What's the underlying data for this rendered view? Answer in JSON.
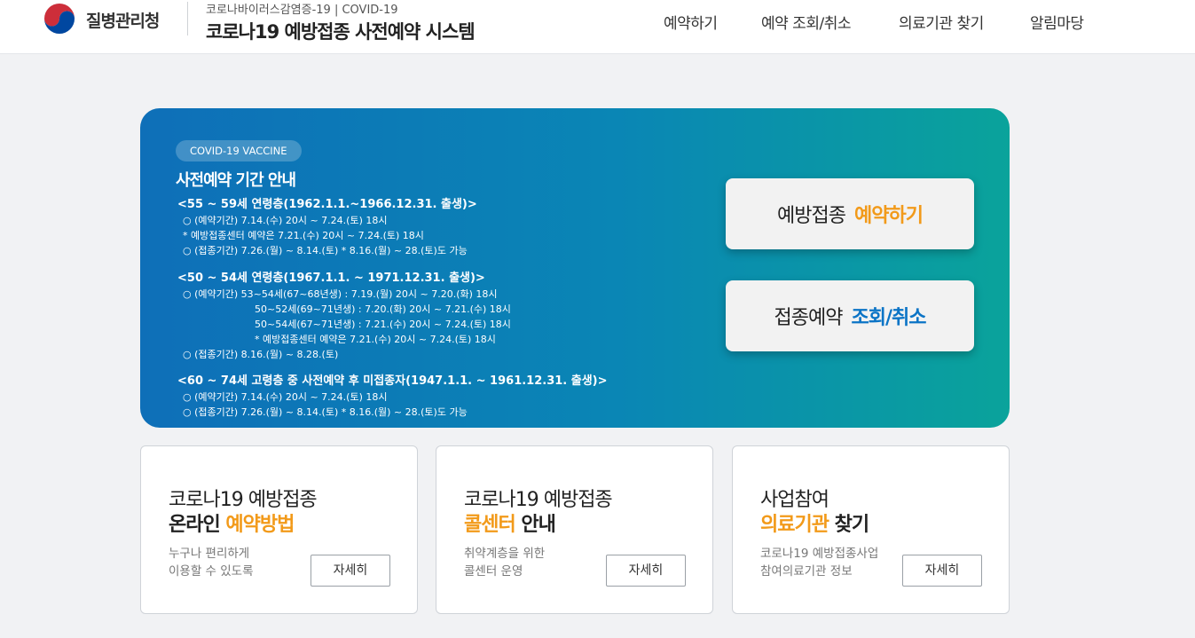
{
  "header": {
    "agency": "질병관리청",
    "subtitle": "코로나바이러스감염증-19 | COVID-19",
    "title": "코로나19 예방접종 사전예약 시스템",
    "nav": [
      "예약하기",
      "예약 조회/취소",
      "의료기관 찾기",
      "알림마당"
    ]
  },
  "hero": {
    "badge": "COVID-19 VACCINE",
    "title": "사전예약 기간 안내",
    "sections": [
      {
        "head": "<55 ~ 59세 연령층(1962.1.1.~1966.12.31. 출생)>",
        "lines": [
          "○ (예약기간) 7.14.(수) 20시 ~ 7.24.(토) 18시",
          " * 예방접종센터 예약은 7.21.(수) 20시 ~ 7.24.(토) 18시",
          "○ (접종기간) 7.26.(월) ~ 8.14.(토)        * 8.16.(월) ~ 28.(토)도 가능"
        ]
      },
      {
        "head": "<50 ~ 54세 연령층(1967.1.1. ~ 1971.12.31. 출생)>",
        "lines": [
          "○ (예약기간) 53~54세(67~68년생) : 7.19.(월) 20시 ~ 7.20.(화) 18시",
          "50~52세(69~71년생) : 7.20.(화) 20시 ~ 7.21.(수) 18시",
          "50~54세(67~71년생) : 7.21.(수) 20시 ~ 7.24.(토) 18시",
          "* 예방접종센터 예약은 7.21.(수) 20시 ~ 7.24.(토) 18시",
          "○ (접종기간) 8.16.(월) ~ 8.28.(토)"
        ]
      },
      {
        "head": "<60 ~ 74세 고령층 중 사전예약 후 미접종자(1947.1.1. ~ 1961.12.31. 출생)>",
        "lines": [
          "○ (예약기간) 7.14.(수) 20시 ~ 7.24.(토) 18시",
          "○ (접종기간) 7.26.(월) ~ 8.14.(토)        * 8.16.(월) ~ 28.(토)도 가능"
        ]
      }
    ],
    "btn_reserve": {
      "part1": "예방접종",
      "part2": "예약하기"
    },
    "btn_lookup": {
      "part1": "접종예약",
      "part2": "조회/취소"
    }
  },
  "cards": [
    {
      "line1": "코로나19 예방접종",
      "line2_a": "온라인 ",
      "line2_b": "예약방법",
      "desc1": "누구나 편리하게",
      "desc2": "이용할 수 있도록",
      "button": "자세히"
    },
    {
      "line1": "코로나19 예방접종",
      "line2_a": "콜센터",
      "line2_b": " 안내",
      "desc1": "취약계층을 위한",
      "desc2": "콜센터 운영",
      "button": "자세히"
    },
    {
      "line1": "사업참여",
      "line2_a": "의료기관",
      "line2_b": " 찾기",
      "desc1": "코로나19 예방접종사업",
      "desc2": "참여의료기관 정보",
      "button": "자세히"
    }
  ],
  "colors": {
    "accent_orange": "#f29a1a",
    "accent_blue": "#0b74c6",
    "hero_start": "#0e6fb8",
    "hero_end": "#0aa39b"
  }
}
